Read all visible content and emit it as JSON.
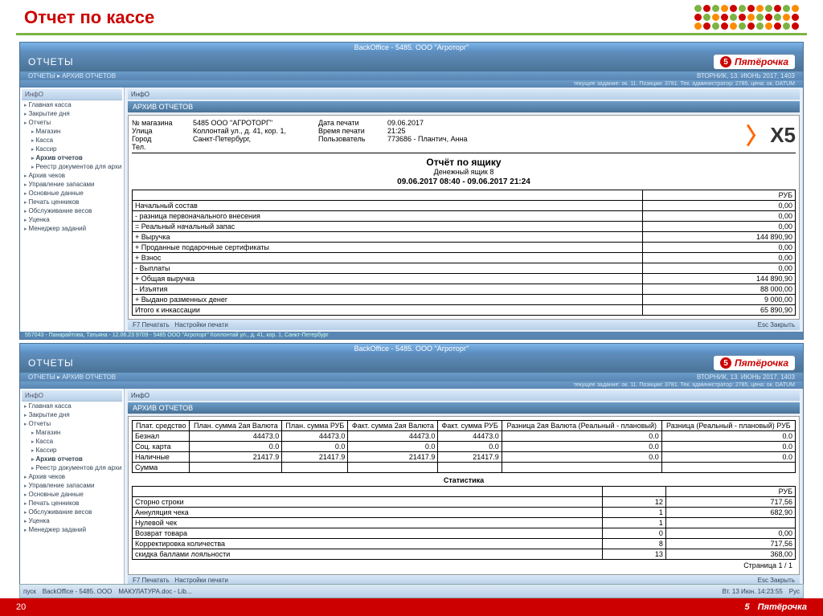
{
  "slide": {
    "title": "Отчет по кассе",
    "page_number": "20",
    "footer_brand": "Пятёрочка"
  },
  "taskbar": {
    "start": "пуск",
    "app1": "BackOffice - 5485. ООО",
    "app2": "МАКУЛАТУРА.doc - Lib...",
    "time": "Вт. 13 Июн. 14:23:55",
    "lang": "Рус"
  },
  "window": {
    "titlebar": "BackOffice - 5485. ООО \"Агроторг\"",
    "header": "ОТЧЕТЫ",
    "brand": "Пятёрочка",
    "date_status": "ВТОРНИК, 13. ИЮНЬ 2017, 1403",
    "breadcrumb": "ОТЧЕТЫ ▸ АРХИВ ОТЧЕТОВ",
    "breadcrumb_right": "текущее задание: ок. 11. Позиции: 3781. Тек. администратор: 2785, цена: ок. DATUM",
    "sidebar_toolbar": "ИнфО",
    "content_toolbar": "ИнфО",
    "archive_title": "АРХИВ ОТЧЕТОВ",
    "footer_print": "F7  Печатать",
    "footer_settings": "Настройки печати",
    "footer_close": "Esc  Закрыть",
    "status": "557043 - Панарайтова, Татьяна - 12.06.23 9709 - 5485 ООО \"Агроторг\" Коллонтай ул., д. 41, кор. 1, Санкт-Петербург"
  },
  "sidebar": {
    "items": [
      {
        "label": "Главная касса",
        "indent": false,
        "bold": false
      },
      {
        "label": "Закрытие дня",
        "indent": false,
        "bold": false
      },
      {
        "label": "Отчеты",
        "indent": false,
        "bold": false
      },
      {
        "label": "Магазин",
        "indent": true,
        "bold": false
      },
      {
        "label": "Касса",
        "indent": true,
        "bold": false
      },
      {
        "label": "Кассир",
        "indent": true,
        "bold": false
      },
      {
        "label": "Архив отчетов",
        "indent": true,
        "bold": true
      },
      {
        "label": "Реестр документов для архи",
        "indent": true,
        "bold": false
      },
      {
        "label": "Архив чеков",
        "indent": false,
        "bold": false
      },
      {
        "label": "Управление запасами",
        "indent": false,
        "bold": false
      },
      {
        "label": "Основные данные",
        "indent": false,
        "bold": false
      },
      {
        "label": "Печать ценников",
        "indent": false,
        "bold": false
      },
      {
        "label": "Обслуживание весов",
        "indent": false,
        "bold": false
      },
      {
        "label": "Уценка",
        "indent": false,
        "bold": false
      },
      {
        "label": "Менеджер заданий",
        "indent": false,
        "bold": false
      }
    ]
  },
  "report1": {
    "info": {
      "store_label": "№ магазина",
      "store": "5485  ООО \"АГРОТОРГ\"",
      "street_label": "Улица",
      "street": "Коллонтай ул., д. 41, кор. 1,",
      "city_label": "Город",
      "city": "Санкт-Петербург,",
      "tel_label": "Тел.",
      "date_label": "Дата печати",
      "date": "09.06.2017",
      "time_label": "Время печати",
      "time": "21:25",
      "user_label": "Пользователь",
      "user": "773686 - Плантич, Анна"
    },
    "title": "Отчёт по ящику",
    "subtitle": "Денежный ящик 8",
    "period": "09.06.2017 08:40 - 09.06.2017 21:24",
    "currency": "РУБ",
    "rows": [
      {
        "label": "Начальный состав",
        "value": "0,00"
      },
      {
        "label": "- разница первоначального внесения",
        "value": "0,00"
      },
      {
        "label": "= Реальный начальный запас",
        "value": "0,00"
      },
      {
        "label": "+ Выручка",
        "value": "144 890,90"
      },
      {
        "label": "+ Проданные подарочные сертификаты",
        "value": "0,00"
      },
      {
        "label": "+ Взнос",
        "value": "0,00"
      },
      {
        "label": "- Выплаты",
        "value": "0,00"
      },
      {
        "label": "+ Общая выручка",
        "value": "144 890,90"
      },
      {
        "label": "- Изъятия",
        "value": "88 000,00"
      },
      {
        "label": "+ Выдано разменных денег",
        "value": "9 000,00"
      },
      {
        "label": "Итого к инкассации",
        "value": "65 890,90"
      }
    ]
  },
  "report2": {
    "headers": [
      "Плат. средство",
      "План. сумма 2ая Валюта",
      "План. сумма РУБ",
      "Факт. сумма 2ая Валюта",
      "Факт. сумма РУБ",
      "Разница 2ая Валюта (Реальный - плановый)",
      "Разница (Реальный - плановый) РУБ"
    ],
    "rows": [
      {
        "c": [
          "Безнал",
          "44473.0",
          "44473.0",
          "44473.0",
          "44473.0",
          "0.0",
          "0.0"
        ]
      },
      {
        "c": [
          "Соц. карта",
          "0.0",
          "0.0",
          "0.0",
          "0.0",
          "0.0",
          "0.0"
        ]
      },
      {
        "c": [
          "Наличные",
          "21417.9",
          "21417.9",
          "21417.9",
          "21417.9",
          "0.0",
          "0.0"
        ]
      },
      {
        "c": [
          "Сумма",
          "",
          "",
          "",
          "",
          "",
          ""
        ]
      }
    ],
    "stats_title": "Статистика",
    "stats_currency": "РУБ",
    "stats": [
      {
        "label": "Сторно строки",
        "count": "12",
        "value": "717,56"
      },
      {
        "label": "Аннуляция чека",
        "count": "1",
        "value": "682,90"
      },
      {
        "label": "Нулевой чек",
        "count": "1",
        "value": ""
      },
      {
        "label": "Возврат товара",
        "count": "0",
        "value": "0,00"
      },
      {
        "label": "Корректировка количества",
        "count": "8",
        "value": "717,56"
      },
      {
        "label": "скидка баллами лояльности",
        "count": "13",
        "value": "368,00"
      }
    ],
    "page": "Страница 1 / 1"
  }
}
